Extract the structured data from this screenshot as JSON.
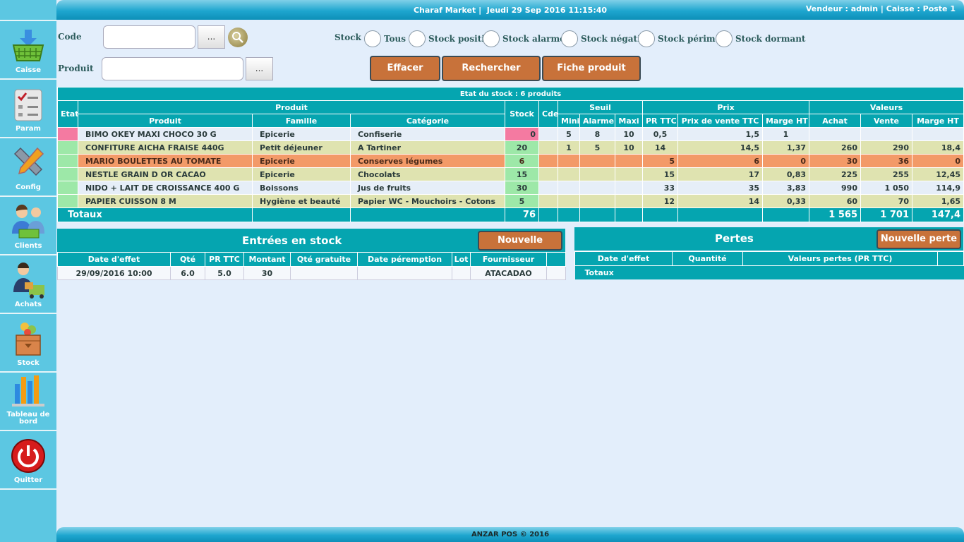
{
  "header": {
    "store": "Charaf Market |",
    "datetime": "Jeudi 29 Sep 2016 11:15:40",
    "session": "Vendeur : admin | Caisse : Poste 1"
  },
  "sidebar": {
    "items": [
      {
        "label": "Caisse",
        "icon": "basket-icon"
      },
      {
        "label": "Param",
        "icon": "checklist-icon"
      },
      {
        "label": "Config",
        "icon": "tools-icon"
      },
      {
        "label": "Clients",
        "icon": "clients-icon"
      },
      {
        "label": "Achats",
        "icon": "purchases-icon"
      },
      {
        "label": "Stock",
        "icon": "stock-box-icon"
      },
      {
        "label": "Tableau de bord",
        "icon": "bar-chart-icon"
      },
      {
        "label": "Quitter",
        "icon": "power-icon"
      }
    ]
  },
  "search": {
    "code_label": "Code",
    "code_value": "",
    "produit_label": "Produit",
    "produit_value": "",
    "dots": "...",
    "stock_label": "Stock",
    "options": [
      "Tous",
      "Stock positif",
      "Stock alarme",
      "Stock négatif",
      "Stock périmé",
      "Stock dormant"
    ]
  },
  "actions": {
    "effacer": "Effacer",
    "rechercher": "Rechercher",
    "fiche": "Fiche produit"
  },
  "stock_table": {
    "caption": "Etat du stock : 6 produits",
    "groups": {
      "etat": "Etat",
      "produit": "Produit",
      "stock": "Stock",
      "cde": "Cde",
      "seuil": "Seuil",
      "prix": "Prix",
      "valeurs": "Valeurs"
    },
    "columns": [
      "Produit",
      "Famille",
      "Catégorie",
      "Mini",
      "Alarme",
      "Maxi",
      "PR TTC",
      "Prix de vente TTC",
      "Marge HT",
      "Achat",
      "Vente",
      "Marge HT"
    ],
    "rows": [
      {
        "produit": "BIMO OKEY MAXI CHOCO 30 G",
        "famille": "Epicerie",
        "categorie": "Confiserie",
        "stock": "0",
        "cde": "",
        "mini": "5",
        "alarme": "8",
        "maxi": "10",
        "pr_ttc": "0,5",
        "prix_vente": "1,5",
        "marge": "1",
        "achat": "",
        "vente": "",
        "marge_ht": ""
      },
      {
        "produit": "CONFITURE AICHA FRAISE 440G",
        "famille": "Petit déjeuner",
        "categorie": "A Tartiner",
        "stock": "20",
        "cde": "",
        "mini": "1",
        "alarme": "5",
        "maxi": "10",
        "pr_ttc": "14",
        "prix_vente": "14,5",
        "marge": "1,37",
        "achat": "260",
        "vente": "290",
        "marge_ht": "18,4"
      },
      {
        "produit": "MARIO BOULETTES AU TOMATE",
        "famille": "Epicerie",
        "categorie": "Conserves légumes",
        "stock": "6",
        "cde": "",
        "mini": "",
        "alarme": "",
        "maxi": "",
        "pr_ttc": "5",
        "prix_vente": "6",
        "marge": "0",
        "achat": "30",
        "vente": "36",
        "marge_ht": "0"
      },
      {
        "produit": "NESTLE GRAIN D OR CACAO",
        "famille": "Epicerie",
        "categorie": "Chocolats",
        "stock": "15",
        "cde": "",
        "mini": "",
        "alarme": "",
        "maxi": "",
        "pr_ttc": "15",
        "prix_vente": "17",
        "marge": "0,83",
        "achat": "225",
        "vente": "255",
        "marge_ht": "12,45"
      },
      {
        "produit": "NIDO + LAIT DE CROISSANCE 400 G",
        "famille": "Boissons",
        "categorie": "Jus de fruits",
        "stock": "30",
        "cde": "",
        "mini": "",
        "alarme": "",
        "maxi": "",
        "pr_ttc": "33",
        "prix_vente": "35",
        "marge": "3,83",
        "achat": "990",
        "vente": "1 050",
        "marge_ht": "114,9"
      },
      {
        "produit": "PAPIER CUISSON 8 M",
        "famille": "Hygiène et beauté",
        "categorie": "Papier WC - Mouchoirs - Cotons",
        "stock": "5",
        "cde": "",
        "mini": "",
        "alarme": "",
        "maxi": "",
        "pr_ttc": "12",
        "prix_vente": "14",
        "marge": "0,33",
        "achat": "60",
        "vente": "70",
        "marge_ht": "1,65"
      }
    ],
    "totals": {
      "label": "Totaux",
      "stock": "76",
      "achat": "1 565",
      "vente": "1 701",
      "marge_ht": "147,4"
    }
  },
  "entries": {
    "title": "Entrées en stock",
    "button": "Nouvelle entrée",
    "columns": [
      "Date d'effet",
      "Qté",
      "PR TTC",
      "Montant",
      "Qté gratuite",
      "Date péremption",
      "Lot",
      "Fournisseur"
    ],
    "rows": [
      {
        "date": "29/09/2016 10:00",
        "qte": "6.0",
        "pr": "5.0",
        "montant": "30",
        "gratuite": "",
        "peremption": "",
        "lot": "",
        "fournisseur": "ATACADAO"
      }
    ]
  },
  "losses": {
    "title": "Pertes",
    "button": "Nouvelle perte",
    "columns": [
      "Date d'effet",
      "Quantité",
      "Valeurs pertes (PR TTC)"
    ],
    "totals": "Totaux"
  },
  "footer": "ANZAR POS © 2016"
}
